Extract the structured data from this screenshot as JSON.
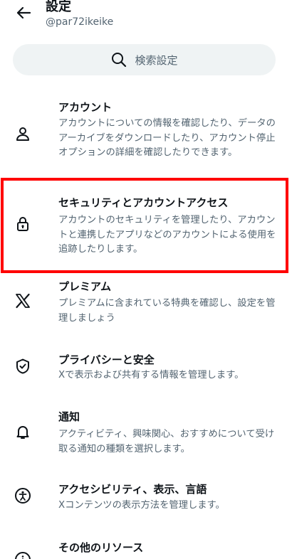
{
  "header": {
    "title": "設定",
    "handle": "@par72ikeike"
  },
  "search": {
    "placeholder": "検索設定"
  },
  "items": [
    {
      "title": "アカウント",
      "desc": "アカウントについての情報を確認したり、データのアーカイブをダウンロードしたり、アカウント停止オプションの詳細を確認したりできます。",
      "icon": "person-icon"
    },
    {
      "title": "セキュリティとアカウントアクセス",
      "desc": "アカウントのセキュリティを管理したり、アカウントと連携したアプリなどのアカウントによる使用を追跡したりします。",
      "icon": "lock-icon"
    },
    {
      "title": "プレミアム",
      "desc": "プレミアムに含まれている特典を確認し、設定を管理しましょう",
      "icon": "x-logo-icon"
    },
    {
      "title": "プライバシーと安全",
      "desc": "Xで表示および共有する情報を管理します。",
      "icon": "shield-check-icon"
    },
    {
      "title": "通知",
      "desc": "アクティビティ、興味関心、おすすめについて受け取る通知の種類を選択します。",
      "icon": "bell-icon"
    },
    {
      "title": "アクセシビリティ、表示、言語",
      "desc": "Xコンテンツの表示方法を管理します。",
      "icon": "accessibility-icon"
    },
    {
      "title": "その他のリソース",
      "desc": "",
      "icon": "info-icon"
    }
  ]
}
